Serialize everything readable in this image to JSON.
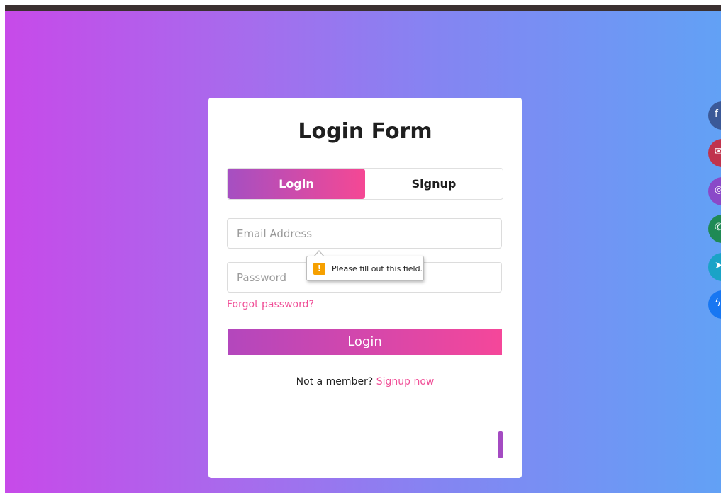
{
  "form": {
    "title": "Login Form",
    "tabs": [
      {
        "label": "Login",
        "active": true
      },
      {
        "label": "Signup",
        "active": false
      }
    ],
    "email": {
      "placeholder": "Email Address",
      "value": ""
    },
    "password": {
      "placeholder": "Password",
      "value": ""
    },
    "forgot_label": "Forgot password?",
    "submit_label": "Login",
    "member_prompt": "Not a member?",
    "signup_link": "Signup now"
  },
  "validation_tooltip": {
    "icon": "warning-icon",
    "message": "Please fill out this field."
  },
  "social_buttons": [
    {
      "name": "facebook-icon",
      "color": "#3b5998"
    },
    {
      "name": "mail-icon",
      "color": "#c0334d"
    },
    {
      "name": "instagram-icon",
      "color": "#8a49c8"
    },
    {
      "name": "whatsapp-icon",
      "color": "#1f8a55"
    },
    {
      "name": "telegram-icon",
      "color": "#1aa3c7"
    },
    {
      "name": "messenger-icon",
      "color": "#1877f2"
    }
  ],
  "colors": {
    "accent_pink": "#f04f97",
    "accent_purple": "#a54fc2",
    "warning": "#f6a000"
  }
}
